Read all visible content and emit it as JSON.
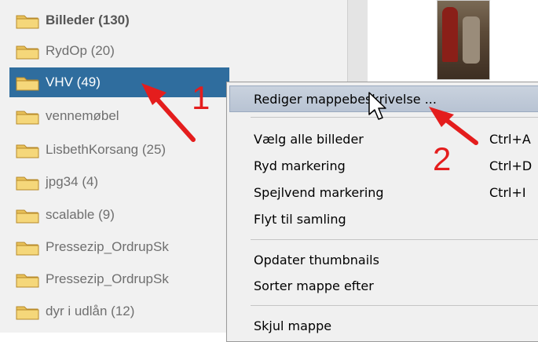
{
  "folder_tree": {
    "items": [
      {
        "label": "Billeder (130)",
        "bold": true,
        "selected": false
      },
      {
        "label": "RydOp (20)",
        "bold": false,
        "selected": false
      },
      {
        "label": "VHV (49)",
        "bold": false,
        "selected": true
      },
      {
        "label": "vennemøbel",
        "bold": false,
        "selected": false
      },
      {
        "label": "LisbethKorsang (25)",
        "bold": false,
        "selected": false
      },
      {
        "label": "jpg34 (4)",
        "bold": false,
        "selected": false
      },
      {
        "label": "scalable (9)",
        "bold": false,
        "selected": false
      },
      {
        "label": "Pressezip_OrdrupSk",
        "bold": false,
        "selected": false
      },
      {
        "label": "Pressezip_OrdrupSk",
        "bold": false,
        "selected": false
      },
      {
        "label": "dyr i udlån (12)",
        "bold": false,
        "selected": false
      }
    ]
  },
  "context_menu": {
    "items": [
      {
        "label": "Rediger mappebeskrivelse ...",
        "shortcut": "",
        "highlighted": true
      },
      {
        "label": "Vælg alle billeder",
        "shortcut": "Ctrl+A"
      },
      {
        "label": "Ryd markering",
        "shortcut": "Ctrl+D"
      },
      {
        "label": "Spejlvend markering",
        "shortcut": "Ctrl+I"
      },
      {
        "label": "Flyt til samling",
        "shortcut": ""
      },
      {
        "label": "Opdater thumbnails",
        "shortcut": ""
      },
      {
        "label": "Sorter mappe efter",
        "shortcut": ""
      },
      {
        "label": "Skjul mappe",
        "shortcut": ""
      }
    ]
  },
  "annotations": {
    "step1": "1",
    "step2": "2",
    "arrow_color": "#e41d1d"
  },
  "colors": {
    "selection": "#2f6d9e",
    "menu_highlight": "#c1cbd9",
    "folder": "#e8c15a"
  }
}
